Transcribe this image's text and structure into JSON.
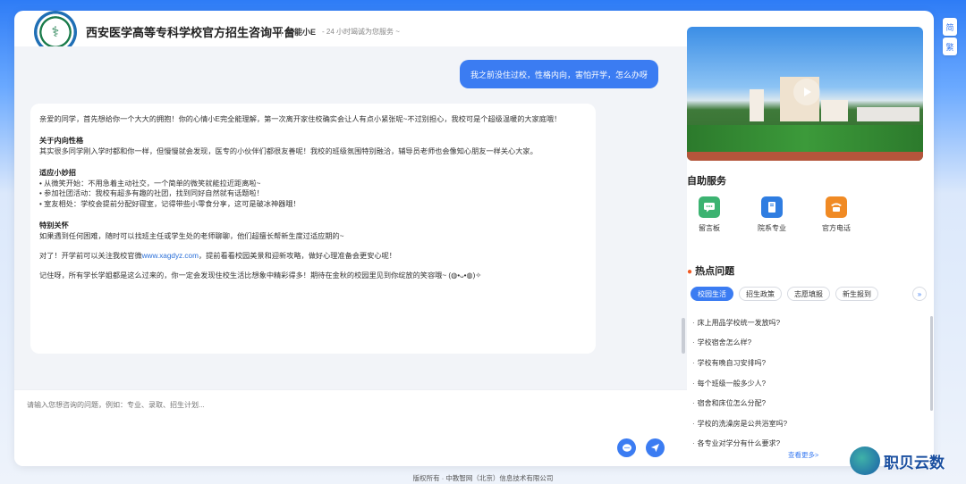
{
  "header": {
    "title": "西安医学高等专科学校官方招生咨询平台",
    "assistant_name": "智能小E",
    "slogan": "- 24 小时竭诚为您服务 ~"
  },
  "chat": {
    "user_message": "我之前没住过校，性格内向，害怕开学，怎么办呀",
    "bot": {
      "intro": "亲爱的同学，首先想给你一个大大的拥抱！你的心情小E完全能理解，第一次离开家住校确实会让人有点小紧张呢~不过别担心，我校可是个超级温暖的大家庭哦！",
      "sec1_title": "关于内向性格",
      "sec1_body": "其实很多同学刚入学时都和你一样，但慢慢就会发现，医专的小伙伴们都很友善呢！我校的班级氛围特别融洽，辅导员老师也会像知心朋友一样关心大家。",
      "sec2_title": "适应小妙招",
      "sec2_items": [
        "• 从微笑开始：不用急着主动社交，一个简单的微笑就能拉近距离啦~",
        "• 参加社团活动：我校有超多有趣的社团，找到同好自然就有话题啦！",
        "• 室友相处：学校会提前分配好寝室，记得带些小零食分享，这可是破冰神器哦！"
      ],
      "sec3_title": "特别关怀",
      "sec3_body": "如果遇到任何困难，随时可以找班主任或学生处的老师聊聊，他们超擅长帮新生度过适应期的~",
      "tip_before": "对了！开学前可以关注我校官微",
      "tip_link": "www.xagdyz.com",
      "tip_after": "，提前看看校园美景和迎新攻略，做好心理准备会更安心呢！",
      "closing": "记住呀，所有学长学姐都是这么过来的，你一定会发现住校生活比想象中精彩得多！期待在金秋的校园里见到你绽放的笑容哦~ (◍•ᴗ•◍)✧"
    }
  },
  "input": {
    "placeholder": "请输入您想咨询的问题，例如：专业、录取、招生计划..."
  },
  "right": {
    "self_service_title": "自助服务",
    "services": [
      {
        "label": "留言板",
        "icon": "message-board-icon",
        "color": "#3cb371"
      },
      {
        "label": "院系专业",
        "icon": "book-icon",
        "color": "#2f7de1"
      },
      {
        "label": "官方电话",
        "icon": "phone-icon",
        "color": "#f08a24"
      }
    ],
    "hot_title": "热点问题",
    "tabs": [
      "校园生活",
      "招生政策",
      "志愿填报",
      "新生报到"
    ],
    "active_tab": "校园生活",
    "questions": [
      "床上用品学校统一发放吗?",
      "学校宿舍怎么样?",
      "学校有晚自习安排吗?",
      "每个班级一般多少人?",
      "宿舍和床位怎么分配?",
      "学校的洗澡房是公共浴室吗?",
      "各专业对学分有什么要求?"
    ],
    "see_more": "查看更多>"
  },
  "side_buttons": [
    "简",
    "繁"
  ],
  "footer": "版权所有 · 中教智网（北京）信息技术有限公司",
  "watermark": "职贝云数",
  "colors": {
    "accent": "#3b7cf2",
    "bg_top": "#2e7cf6"
  }
}
